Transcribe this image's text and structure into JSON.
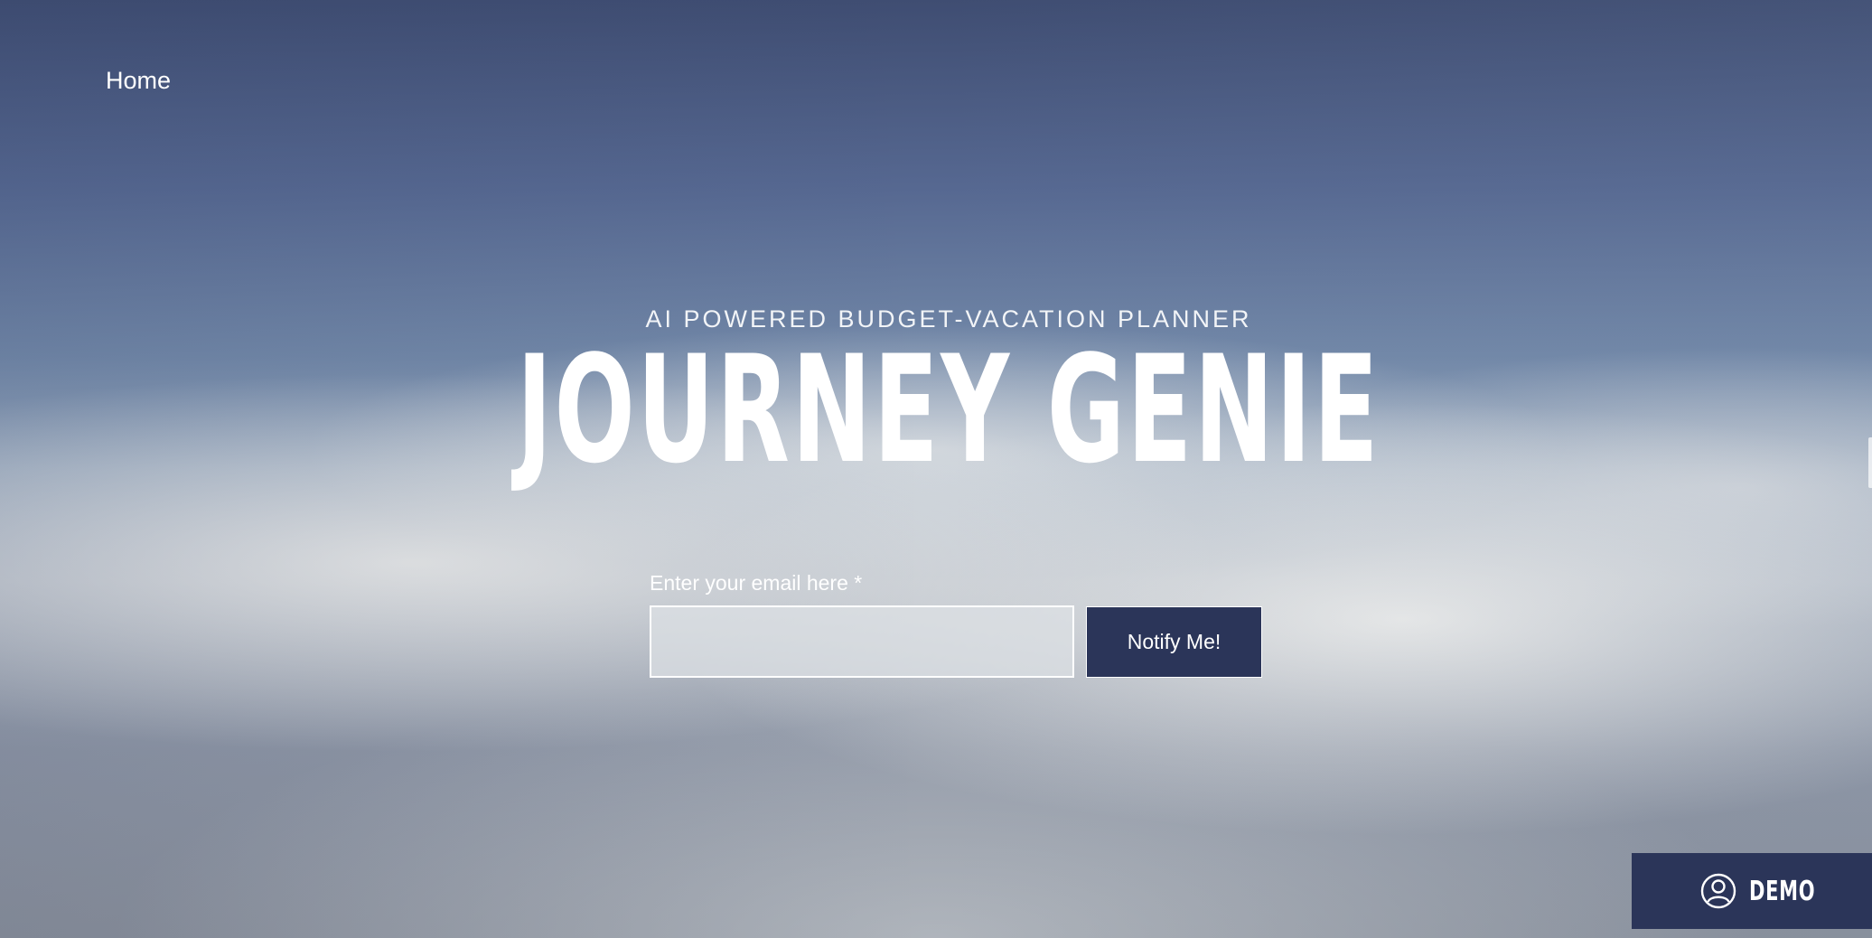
{
  "nav": {
    "home_label": "Home"
  },
  "hero": {
    "tagline": "AI POWERED BUDGET-VACATION PLANNER",
    "title": "JOURNEY GENIE"
  },
  "signup": {
    "email_label": "Enter your email here *",
    "email_value": "",
    "email_placeholder": "",
    "notify_label": "Notify Me!"
  },
  "demo": {
    "label": "DEMO",
    "icon": "user-circle-icon"
  },
  "colors": {
    "button_bg": "#2b3559",
    "text": "#ffffff"
  }
}
